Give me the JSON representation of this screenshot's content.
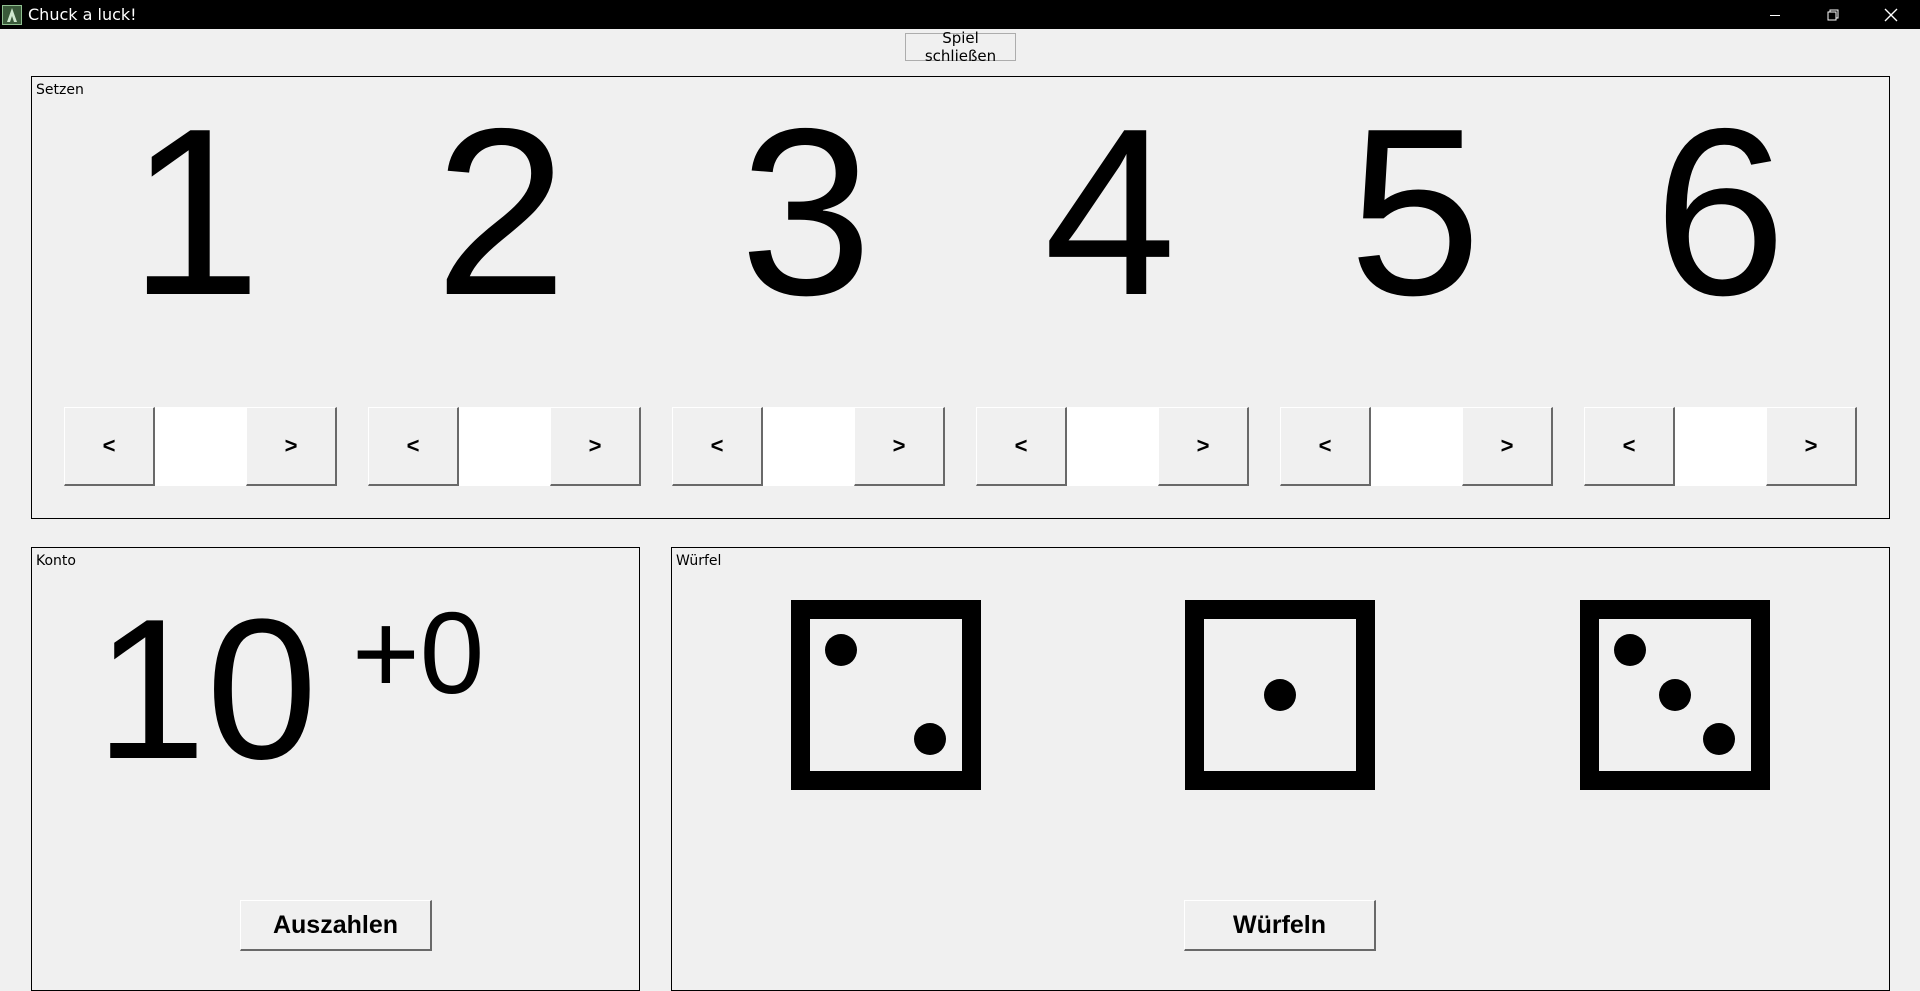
{
  "window": {
    "title": "Chuck a luck!"
  },
  "toolbar": {
    "close_game_label": "Spiel schließen"
  },
  "bet_panel": {
    "label": "Setzen",
    "numbers": [
      "1",
      "2",
      "3",
      "4",
      "5",
      "6"
    ],
    "decrease_label": "<",
    "increase_label": ">",
    "bets": [
      "",
      "",
      "",
      "",
      "",
      ""
    ]
  },
  "account": {
    "label": "Konto",
    "balance": "10",
    "delta": "+0",
    "payout_label": "Auszahlen"
  },
  "dice_panel": {
    "label": "Würfel",
    "dice": [
      2,
      1,
      3
    ],
    "roll_label": "Würfeln"
  }
}
